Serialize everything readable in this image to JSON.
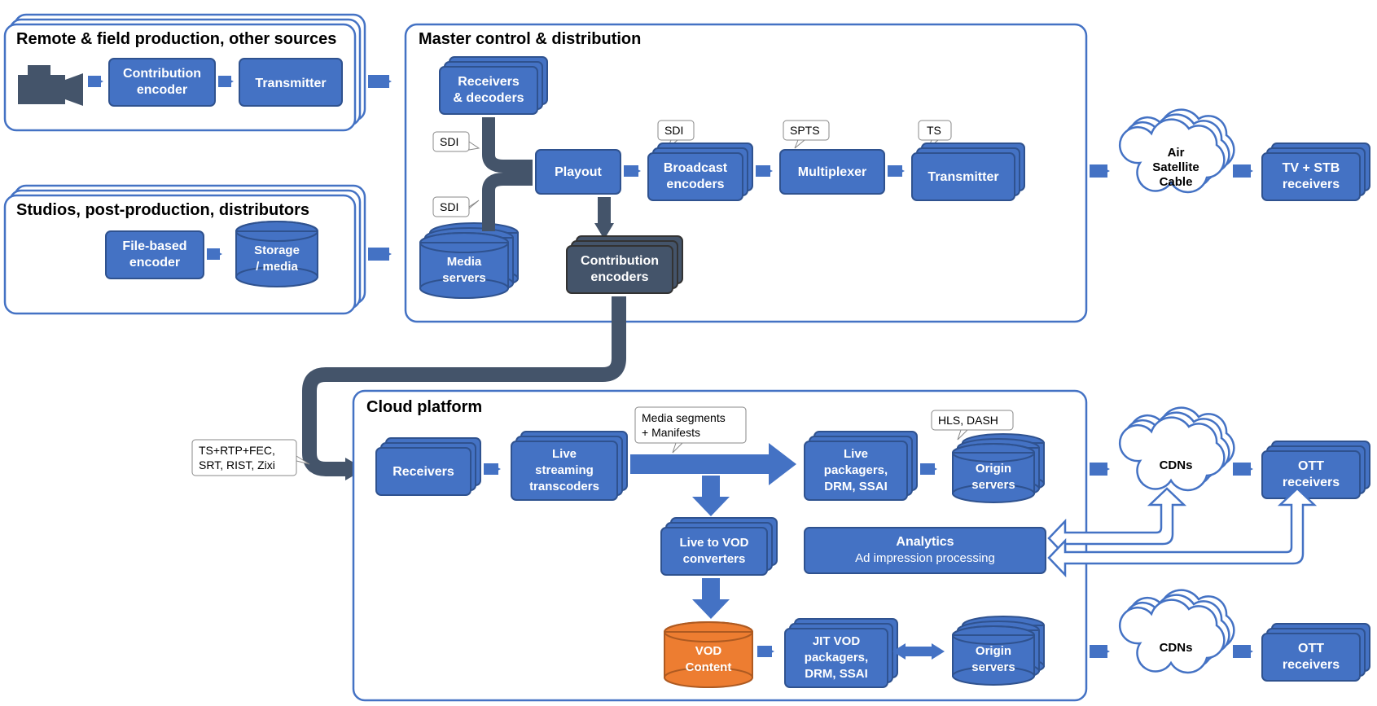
{
  "sections": {
    "remote_title": "Remote & field production, other sources",
    "studios_title": "Studios, post-production, distributors",
    "master_title": "Master control & distribution",
    "cloud_title": "Cloud platform"
  },
  "boxes": {
    "contribution_encoder_l1": "Contribution",
    "contribution_encoder_l2": "encoder",
    "transmitter": "Transmitter",
    "file_encoder_l1": "File-based",
    "file_encoder_l2": "encoder",
    "storage_l1": "Storage",
    "storage_l2": "/ media",
    "receivers_decoders_l1": "Receivers",
    "receivers_decoders_l2": "& decoders",
    "playout": "Playout",
    "broadcast_l1": "Broadcast",
    "broadcast_l2": "encoders",
    "multiplexer": "Multiplexer",
    "transmitter2": "Transmitter",
    "air_l1": "Air",
    "air_l2": "Satellite",
    "air_l3": "Cable",
    "tv_l1": "TV + STB",
    "tv_l2": "receivers",
    "media_servers_l1": "Media",
    "media_servers_l2": "servers",
    "contribution_encoders2_l1": "Contribution",
    "contribution_encoders2_l2": "encoders",
    "receivers2": "Receivers",
    "live_stream_l1": "Live",
    "live_stream_l2": "streaming",
    "live_stream_l3": "transcoders",
    "live_pack_l1": "Live",
    "live_pack_l2": "packagers,",
    "live_pack_l3": "DRM, SSAI",
    "origin_l1": "Origin",
    "origin_l2": "servers",
    "cdns": "CDNs",
    "ott_l1": "OTT",
    "ott_l2": "receivers",
    "l2v_l1": "Live to VOD",
    "l2v_l2": "converters",
    "analytics_l1": "Analytics",
    "analytics_l2": "Ad impression processing",
    "vod_l1": "VOD",
    "vod_l2": "Content",
    "jitvod_l1": "JIT VOD",
    "jitvod_l2": "packagers,",
    "jitvod_l3": "DRM, SSAI"
  },
  "callouts": {
    "sdi1": "SDI",
    "sdi2": "SDI",
    "sdi3": "SDI",
    "spts": "SPTS",
    "ts": "TS",
    "media_seg_l1": "Media segments",
    "media_seg_l2": "+ Manifests",
    "hls_dash": "HLS, DASH",
    "ts_rtp_l1": "TS+RTP+FEC,",
    "ts_rtp_l2": "SRT, RIST, Zixi"
  },
  "colors": {
    "blue": "#4472C4",
    "dark": "#44546A",
    "orange": "#ED7D31",
    "border": "#2F528F"
  }
}
